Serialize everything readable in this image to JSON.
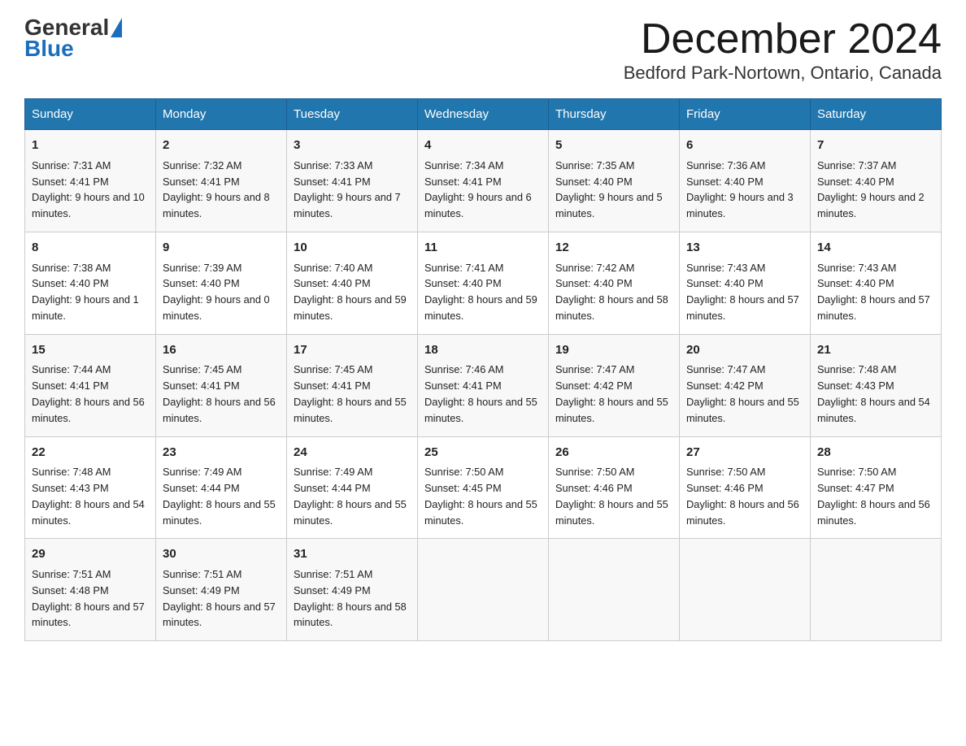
{
  "header": {
    "logo_general": "General",
    "logo_blue": "Blue",
    "month_title": "December 2024",
    "location": "Bedford Park-Nortown, Ontario, Canada"
  },
  "days_of_week": [
    "Sunday",
    "Monday",
    "Tuesday",
    "Wednesday",
    "Thursday",
    "Friday",
    "Saturday"
  ],
  "weeks": [
    [
      {
        "day": "1",
        "sunrise": "Sunrise: 7:31 AM",
        "sunset": "Sunset: 4:41 PM",
        "daylight": "Daylight: 9 hours and 10 minutes."
      },
      {
        "day": "2",
        "sunrise": "Sunrise: 7:32 AM",
        "sunset": "Sunset: 4:41 PM",
        "daylight": "Daylight: 9 hours and 8 minutes."
      },
      {
        "day": "3",
        "sunrise": "Sunrise: 7:33 AM",
        "sunset": "Sunset: 4:41 PM",
        "daylight": "Daylight: 9 hours and 7 minutes."
      },
      {
        "day": "4",
        "sunrise": "Sunrise: 7:34 AM",
        "sunset": "Sunset: 4:41 PM",
        "daylight": "Daylight: 9 hours and 6 minutes."
      },
      {
        "day": "5",
        "sunrise": "Sunrise: 7:35 AM",
        "sunset": "Sunset: 4:40 PM",
        "daylight": "Daylight: 9 hours and 5 minutes."
      },
      {
        "day": "6",
        "sunrise": "Sunrise: 7:36 AM",
        "sunset": "Sunset: 4:40 PM",
        "daylight": "Daylight: 9 hours and 3 minutes."
      },
      {
        "day": "7",
        "sunrise": "Sunrise: 7:37 AM",
        "sunset": "Sunset: 4:40 PM",
        "daylight": "Daylight: 9 hours and 2 minutes."
      }
    ],
    [
      {
        "day": "8",
        "sunrise": "Sunrise: 7:38 AM",
        "sunset": "Sunset: 4:40 PM",
        "daylight": "Daylight: 9 hours and 1 minute."
      },
      {
        "day": "9",
        "sunrise": "Sunrise: 7:39 AM",
        "sunset": "Sunset: 4:40 PM",
        "daylight": "Daylight: 9 hours and 0 minutes."
      },
      {
        "day": "10",
        "sunrise": "Sunrise: 7:40 AM",
        "sunset": "Sunset: 4:40 PM",
        "daylight": "Daylight: 8 hours and 59 minutes."
      },
      {
        "day": "11",
        "sunrise": "Sunrise: 7:41 AM",
        "sunset": "Sunset: 4:40 PM",
        "daylight": "Daylight: 8 hours and 59 minutes."
      },
      {
        "day": "12",
        "sunrise": "Sunrise: 7:42 AM",
        "sunset": "Sunset: 4:40 PM",
        "daylight": "Daylight: 8 hours and 58 minutes."
      },
      {
        "day": "13",
        "sunrise": "Sunrise: 7:43 AM",
        "sunset": "Sunset: 4:40 PM",
        "daylight": "Daylight: 8 hours and 57 minutes."
      },
      {
        "day": "14",
        "sunrise": "Sunrise: 7:43 AM",
        "sunset": "Sunset: 4:40 PM",
        "daylight": "Daylight: 8 hours and 57 minutes."
      }
    ],
    [
      {
        "day": "15",
        "sunrise": "Sunrise: 7:44 AM",
        "sunset": "Sunset: 4:41 PM",
        "daylight": "Daylight: 8 hours and 56 minutes."
      },
      {
        "day": "16",
        "sunrise": "Sunrise: 7:45 AM",
        "sunset": "Sunset: 4:41 PM",
        "daylight": "Daylight: 8 hours and 56 minutes."
      },
      {
        "day": "17",
        "sunrise": "Sunrise: 7:45 AM",
        "sunset": "Sunset: 4:41 PM",
        "daylight": "Daylight: 8 hours and 55 minutes."
      },
      {
        "day": "18",
        "sunrise": "Sunrise: 7:46 AM",
        "sunset": "Sunset: 4:41 PM",
        "daylight": "Daylight: 8 hours and 55 minutes."
      },
      {
        "day": "19",
        "sunrise": "Sunrise: 7:47 AM",
        "sunset": "Sunset: 4:42 PM",
        "daylight": "Daylight: 8 hours and 55 minutes."
      },
      {
        "day": "20",
        "sunrise": "Sunrise: 7:47 AM",
        "sunset": "Sunset: 4:42 PM",
        "daylight": "Daylight: 8 hours and 55 minutes."
      },
      {
        "day": "21",
        "sunrise": "Sunrise: 7:48 AM",
        "sunset": "Sunset: 4:43 PM",
        "daylight": "Daylight: 8 hours and 54 minutes."
      }
    ],
    [
      {
        "day": "22",
        "sunrise": "Sunrise: 7:48 AM",
        "sunset": "Sunset: 4:43 PM",
        "daylight": "Daylight: 8 hours and 54 minutes."
      },
      {
        "day": "23",
        "sunrise": "Sunrise: 7:49 AM",
        "sunset": "Sunset: 4:44 PM",
        "daylight": "Daylight: 8 hours and 55 minutes."
      },
      {
        "day": "24",
        "sunrise": "Sunrise: 7:49 AM",
        "sunset": "Sunset: 4:44 PM",
        "daylight": "Daylight: 8 hours and 55 minutes."
      },
      {
        "day": "25",
        "sunrise": "Sunrise: 7:50 AM",
        "sunset": "Sunset: 4:45 PM",
        "daylight": "Daylight: 8 hours and 55 minutes."
      },
      {
        "day": "26",
        "sunrise": "Sunrise: 7:50 AM",
        "sunset": "Sunset: 4:46 PM",
        "daylight": "Daylight: 8 hours and 55 minutes."
      },
      {
        "day": "27",
        "sunrise": "Sunrise: 7:50 AM",
        "sunset": "Sunset: 4:46 PM",
        "daylight": "Daylight: 8 hours and 56 minutes."
      },
      {
        "day": "28",
        "sunrise": "Sunrise: 7:50 AM",
        "sunset": "Sunset: 4:47 PM",
        "daylight": "Daylight: 8 hours and 56 minutes."
      }
    ],
    [
      {
        "day": "29",
        "sunrise": "Sunrise: 7:51 AM",
        "sunset": "Sunset: 4:48 PM",
        "daylight": "Daylight: 8 hours and 57 minutes."
      },
      {
        "day": "30",
        "sunrise": "Sunrise: 7:51 AM",
        "sunset": "Sunset: 4:49 PM",
        "daylight": "Daylight: 8 hours and 57 minutes."
      },
      {
        "day": "31",
        "sunrise": "Sunrise: 7:51 AM",
        "sunset": "Sunset: 4:49 PM",
        "daylight": "Daylight: 8 hours and 58 minutes."
      },
      null,
      null,
      null,
      null
    ]
  ]
}
